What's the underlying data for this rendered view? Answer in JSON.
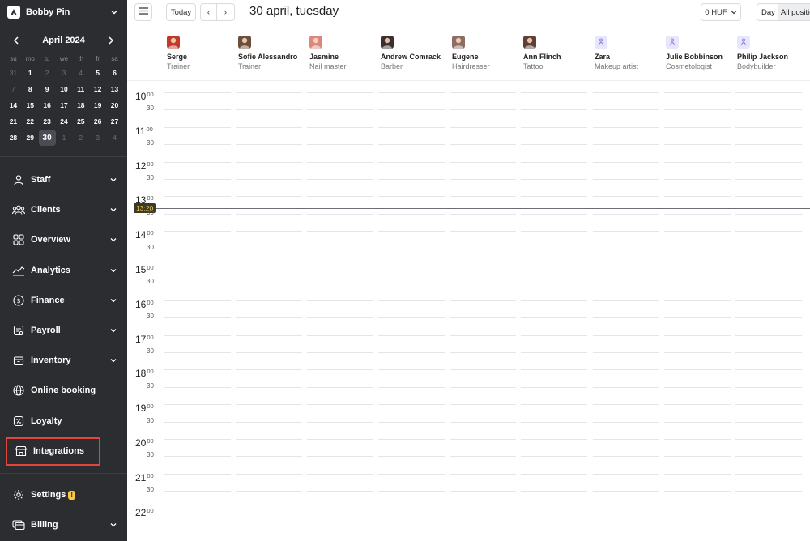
{
  "sidebar": {
    "account_name": "Bobby Pin",
    "calendar": {
      "month_label": "April 2024",
      "weekdays": [
        "su",
        "mo",
        "tu",
        "we",
        "th",
        "fr",
        "sa"
      ],
      "weeks": [
        [
          {
            "d": "31",
            "m": true
          },
          {
            "d": "1"
          },
          {
            "d": "2",
            "m": true
          },
          {
            "d": "3",
            "m": true
          },
          {
            "d": "4",
            "m": true
          },
          {
            "d": "5"
          },
          {
            "d": "6"
          }
        ],
        [
          {
            "d": "7",
            "m": true
          },
          {
            "d": "8"
          },
          {
            "d": "9"
          },
          {
            "d": "10"
          },
          {
            "d": "11"
          },
          {
            "d": "12"
          },
          {
            "d": "13"
          }
        ],
        [
          {
            "d": "14"
          },
          {
            "d": "15"
          },
          {
            "d": "16"
          },
          {
            "d": "17"
          },
          {
            "d": "18"
          },
          {
            "d": "19"
          },
          {
            "d": "20"
          }
        ],
        [
          {
            "d": "21"
          },
          {
            "d": "22"
          },
          {
            "d": "23"
          },
          {
            "d": "24"
          },
          {
            "d": "25"
          },
          {
            "d": "26"
          },
          {
            "d": "27"
          }
        ],
        [
          {
            "d": "28"
          },
          {
            "d": "29"
          },
          {
            "d": "30",
            "t": true
          },
          {
            "d": "1",
            "m": true
          },
          {
            "d": "2",
            "m": true
          },
          {
            "d": "3",
            "m": true
          },
          {
            "d": "4",
            "m": true
          }
        ]
      ]
    },
    "menu": [
      {
        "key": "staff",
        "label": "Staff",
        "icon": "user-icon",
        "chevron": true
      },
      {
        "key": "clients",
        "label": "Clients",
        "icon": "users-icon",
        "chevron": true
      },
      {
        "key": "overview",
        "label": "Overview",
        "icon": "grid-icon",
        "chevron": true
      },
      {
        "key": "analytics",
        "label": "Analytics",
        "icon": "analytics-icon",
        "chevron": true
      },
      {
        "key": "finance",
        "label": "Finance",
        "icon": "dollar-icon",
        "chevron": true
      },
      {
        "key": "payroll",
        "label": "Payroll",
        "icon": "payroll-icon",
        "chevron": true
      },
      {
        "key": "inventory",
        "label": "Inventory",
        "icon": "box-icon",
        "chevron": true
      },
      {
        "key": "online-booking",
        "label": "Online booking",
        "icon": "globe-icon",
        "chevron": false
      },
      {
        "key": "loyalty",
        "label": "Loyalty",
        "icon": "loyalty-icon",
        "chevron": false
      },
      {
        "key": "integrations",
        "label": "Integrations",
        "icon": "store-icon",
        "chevron": false,
        "highlight": true
      }
    ],
    "bottom_menu": [
      {
        "key": "settings",
        "label": "Settings",
        "icon": "gear-icon",
        "chevron": false,
        "badge": "!"
      },
      {
        "key": "billing",
        "label": "Billing",
        "icon": "billing-icon",
        "chevron": true
      }
    ]
  },
  "topbar": {
    "today_label": "Today",
    "prev_label": "‹",
    "next_label": "›",
    "date_title": "30 april, tuesday",
    "currency_label": "0 HUF",
    "view_label": "Day",
    "positions_label": "All positions"
  },
  "staff": [
    {
      "name": "Serge",
      "role": "Trainer",
      "avatar": "photo",
      "color": "#c0392b"
    },
    {
      "name": "Sofie Alessandro",
      "role": "Trainer",
      "avatar": "photo",
      "color": "#6b4f3a"
    },
    {
      "name": "Jasmine",
      "role": "Nail master",
      "avatar": "photo",
      "color": "#d98880"
    },
    {
      "name": "Andrew Comrack",
      "role": "Barber",
      "avatar": "photo",
      "color": "#3b2f2f"
    },
    {
      "name": "Eugene",
      "role": "Hairdresser",
      "avatar": "photo",
      "color": "#8d6e63"
    },
    {
      "name": "Ann Flinch",
      "role": "Tattoo",
      "avatar": "photo",
      "color": "#5d4037"
    },
    {
      "name": "Zara",
      "role": "Makeup artist",
      "avatar": "placeholder",
      "color": "#e8e6fb"
    },
    {
      "name": "Julie Bobbinson",
      "role": "Cosmetologist",
      "avatar": "placeholder",
      "color": "#e8e6fb"
    },
    {
      "name": "Philip Jackson",
      "role": "Bodybuilder",
      "avatar": "placeholder",
      "color": "#e8e6fb"
    }
  ],
  "timeline": {
    "hours": [
      "10",
      "11",
      "12",
      "13",
      "14",
      "15",
      "16",
      "17",
      "18",
      "19",
      "20",
      "21",
      "22"
    ],
    "hour_suffix": "00",
    "half_label": "30",
    "current_time": "13:20"
  },
  "colors": {
    "sidebar_bg": "#2b2d31",
    "highlight_border": "#e0463c",
    "badge": "#f7c948",
    "avatar_placeholder_icon": "#8e7fe0"
  }
}
